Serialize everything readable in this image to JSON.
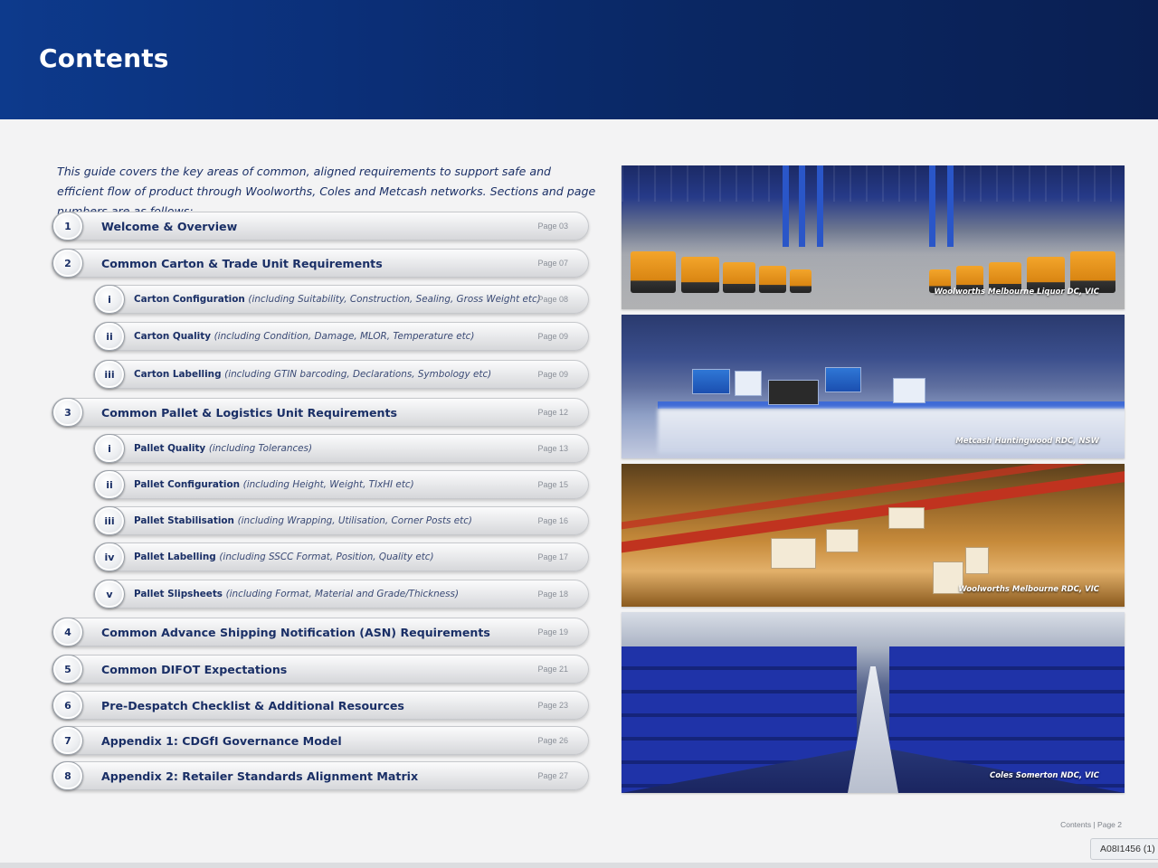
{
  "header": {
    "title": "Contents"
  },
  "intro": "This guide covers the key areas of common, aligned requirements to support safe and efficient flow of product through Woolworths, Coles and Metcash networks.  Sections and page numbers are as follows:",
  "toc": {
    "items": [
      {
        "num": "1",
        "title": "Welcome & Overview",
        "note": "",
        "page": "Page 03"
      },
      {
        "num": "2",
        "title": "Common Carton & Trade Unit Requirements",
        "note": "",
        "page": "Page 07"
      },
      {
        "num": "i",
        "title": "Carton Configuration",
        "note": "(including Suitability, Construction, Sealing, Gross Weight etc)",
        "page": "Page 08"
      },
      {
        "num": "ii",
        "title": "Carton Quality",
        "note": "(including Condition, Damage, MLOR, Temperature etc)",
        "page": "Page 09"
      },
      {
        "num": "iii",
        "title": "Carton Labelling",
        "note": "(including GTIN barcoding, Declarations, Symbology etc)",
        "page": "Page 09"
      },
      {
        "num": "3",
        "title": "Common Pallet & Logistics Unit Requirements",
        "note": "",
        "page": "Page 12"
      },
      {
        "num": "i",
        "title": "Pallet Quality",
        "note": "(including Tolerances)",
        "page": "Page 13"
      },
      {
        "num": "ii",
        "title": "Pallet Configuration",
        "note": "(including Height, Weight, TIxHI etc)",
        "page": "Page 15"
      },
      {
        "num": "iii",
        "title": "Pallet Stabilisation",
        "note": "(including Wrapping, Utilisation, Corner Posts etc)",
        "page": "Page 16"
      },
      {
        "num": "iv",
        "title": "Pallet Labelling",
        "note": "(including SSCC Format, Position, Quality etc)",
        "page": "Page 17"
      },
      {
        "num": "v",
        "title": "Pallet Slipsheets",
        "note": "(including Format, Material and Grade/Thickness)",
        "page": "Page 18"
      },
      {
        "num": "4",
        "title": "Common Advance Shipping Notification (ASN) Requirements",
        "note": "",
        "page": "Page 19"
      },
      {
        "num": "5",
        "title": "Common DIFOT Expectations",
        "note": "",
        "page": "Page 21"
      },
      {
        "num": "6",
        "title": "Pre-Despatch Checklist & Additional Resources",
        "note": "",
        "page": "Page 23"
      },
      {
        "num": "7",
        "title": "Appendix 1:  CDGfI Governance Model",
        "note": "",
        "page": "Page 26"
      },
      {
        "num": "8",
        "title": "Appendix 2: Retailer Standards Alignment Matrix",
        "note": "",
        "page": "Page 27"
      }
    ]
  },
  "photos": {
    "p1_caption": "Woolworths Melbourne Liquor DC, VIC",
    "p2_caption": "Metcash Huntingwood RDC, NSW",
    "p3_caption": "Woolworths Melbourne RDC, VIC",
    "p4_caption": "Coles Somerton NDC, VIC"
  },
  "footer": {
    "page_label": "Contents | Page 2"
  },
  "tag": {
    "text": "A08I1456 (1)"
  }
}
